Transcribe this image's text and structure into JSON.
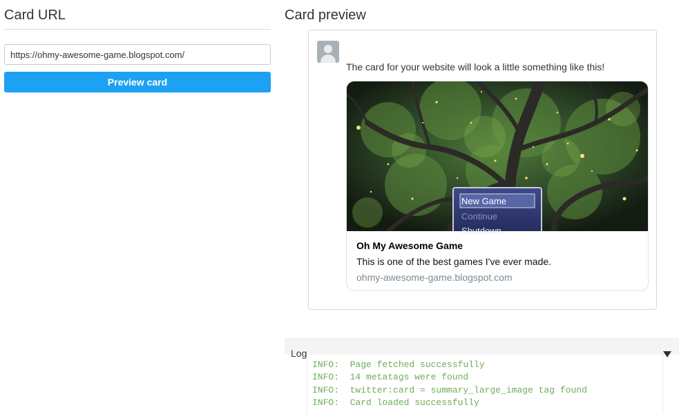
{
  "left": {
    "title": "Card URL",
    "url_value": "https://ohmy-awesome-game.blogspot.com/",
    "preview_button_label": "Preview card"
  },
  "right": {
    "title": "Card preview",
    "tweet_text": "The card for your website will look a little something like this!",
    "card": {
      "image_menu": [
        "New Game",
        "Continue",
        "Shutdown"
      ],
      "title": "Oh My Awesome Game",
      "description": "This is one of the best games I've ever made.",
      "domain": "ohmy-awesome-game.blogspot.com"
    }
  },
  "log": {
    "label": "Log",
    "lines": [
      "INFO:  Page fetched successfully",
      "INFO:  14 metatags were found",
      "INFO:  twitter:card = summary_large_image tag found",
      "INFO:  Card loaded successfully"
    ]
  },
  "colors": {
    "accent": "#1da1f2",
    "log_text": "#6cad5a"
  }
}
